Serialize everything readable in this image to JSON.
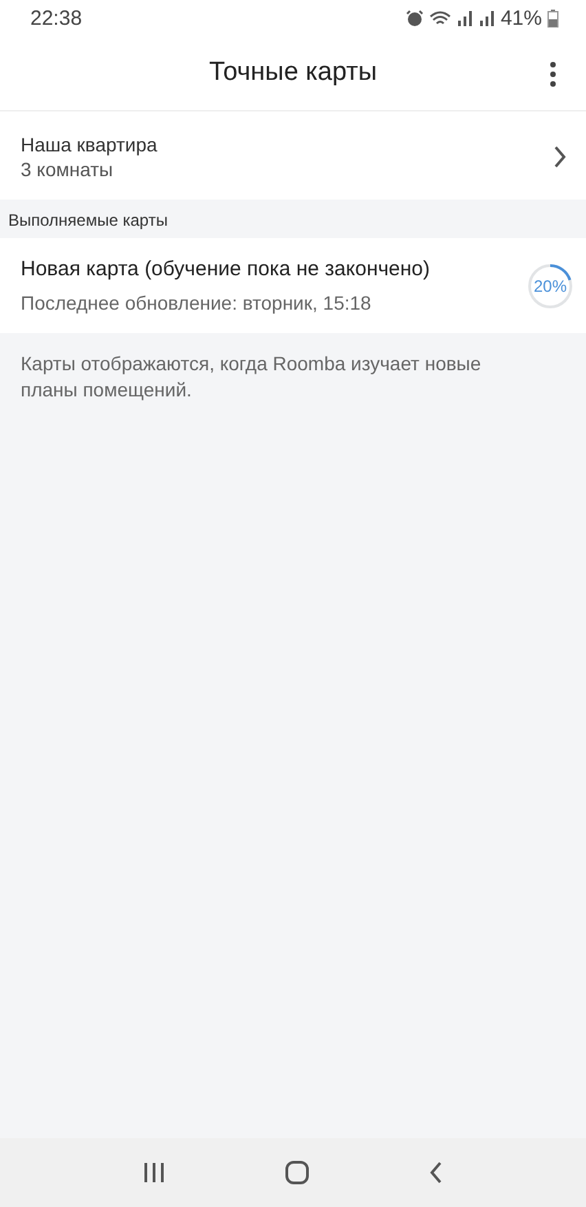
{
  "status_bar": {
    "time": "22:38",
    "battery": "41%"
  },
  "header": {
    "title": "Точные карты"
  },
  "home_map": {
    "name": "Наша квартира",
    "subtitle": "3 комнаты"
  },
  "section": {
    "title": "Выполняемые карты"
  },
  "maps_in_progress": [
    {
      "name": "Новая карта  (обучение пока не закончено)",
      "updated": "Последнее обновление: вторник, 15:18",
      "level": 0.2,
      "percent": "20%"
    }
  ],
  "note": "Карты отображаются, когда Roomba изучает новые планы помещений."
}
